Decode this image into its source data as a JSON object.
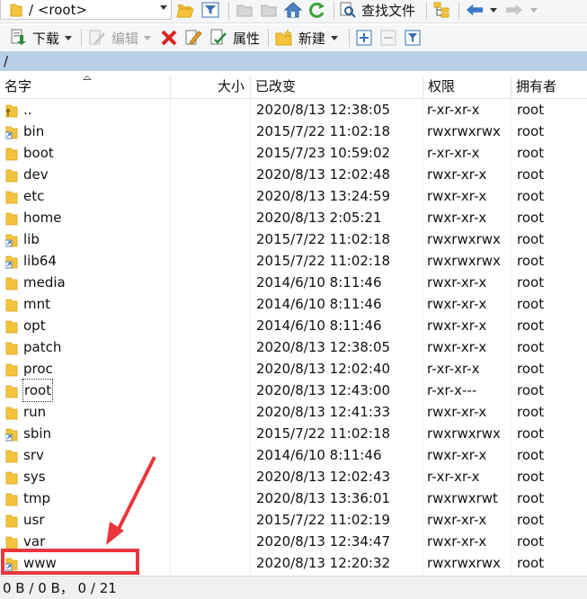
{
  "toolbar_top": {
    "path_value": "/ <root>",
    "find_label": "查找文件"
  },
  "toolbar_main": {
    "download_label": "下载",
    "edit_label": "编辑",
    "properties_label": "属性",
    "new_label": "新建"
  },
  "path_bar": {
    "path": "/"
  },
  "columns": {
    "name": "名字",
    "size": "大小",
    "modified": "已改变",
    "permissions": "权限",
    "owner": "拥有者"
  },
  "rows": [
    {
      "name": "..",
      "modified": "2020/8/13 12:38:05",
      "permissions": "r-xr-xr-x",
      "owner": "root",
      "icon": "parent-folder-icon"
    },
    {
      "name": "bin",
      "modified": "2015/7/22 11:02:18",
      "permissions": "rwxrwxrwx",
      "owner": "root",
      "icon": "folder-link-icon"
    },
    {
      "name": "boot",
      "modified": "2015/7/23 10:59:02",
      "permissions": "r-xr-xr-x",
      "owner": "root",
      "icon": "folder-icon"
    },
    {
      "name": "dev",
      "modified": "2020/8/13 12:02:48",
      "permissions": "rwxr-xr-x",
      "owner": "root",
      "icon": "folder-icon"
    },
    {
      "name": "etc",
      "modified": "2020/8/13 13:24:59",
      "permissions": "rwxr-xr-x",
      "owner": "root",
      "icon": "folder-icon"
    },
    {
      "name": "home",
      "modified": "2020/8/13 2:05:21",
      "permissions": "rwxr-xr-x",
      "owner": "root",
      "icon": "folder-icon"
    },
    {
      "name": "lib",
      "modified": "2015/7/22 11:02:18",
      "permissions": "rwxrwxrwx",
      "owner": "root",
      "icon": "folder-link-icon"
    },
    {
      "name": "lib64",
      "modified": "2015/7/22 11:02:18",
      "permissions": "rwxrwxrwx",
      "owner": "root",
      "icon": "folder-link-icon"
    },
    {
      "name": "media",
      "modified": "2014/6/10 8:11:46",
      "permissions": "rwxr-xr-x",
      "owner": "root",
      "icon": "folder-icon"
    },
    {
      "name": "mnt",
      "modified": "2014/6/10 8:11:46",
      "permissions": "rwxr-xr-x",
      "owner": "root",
      "icon": "folder-icon"
    },
    {
      "name": "opt",
      "modified": "2014/6/10 8:11:46",
      "permissions": "rwxr-xr-x",
      "owner": "root",
      "icon": "folder-icon"
    },
    {
      "name": "patch",
      "modified": "2020/8/13 12:38:05",
      "permissions": "rwxr-xr-x",
      "owner": "root",
      "icon": "folder-icon"
    },
    {
      "name": "proc",
      "modified": "2020/8/13 12:02:40",
      "permissions": "r-xr-xr-x",
      "owner": "root",
      "icon": "folder-icon"
    },
    {
      "name": "root",
      "modified": "2020/8/13 12:43:00",
      "permissions": "r-xr-x---",
      "owner": "root",
      "icon": "folder-icon",
      "focused": true
    },
    {
      "name": "run",
      "modified": "2020/8/13 12:41:33",
      "permissions": "rwxr-xr-x",
      "owner": "root",
      "icon": "folder-icon"
    },
    {
      "name": "sbin",
      "modified": "2015/7/22 11:02:18",
      "permissions": "rwxrwxrwx",
      "owner": "root",
      "icon": "folder-link-icon"
    },
    {
      "name": "srv",
      "modified": "2014/6/10 8:11:46",
      "permissions": "rwxr-xr-x",
      "owner": "root",
      "icon": "folder-icon"
    },
    {
      "name": "sys",
      "modified": "2020/8/13 12:02:43",
      "permissions": "r-xr-xr-x",
      "owner": "root",
      "icon": "folder-icon"
    },
    {
      "name": "tmp",
      "modified": "2020/8/13 13:36:01",
      "permissions": "rwxrwxrwt",
      "owner": "root",
      "icon": "folder-icon"
    },
    {
      "name": "usr",
      "modified": "2015/7/22 11:02:19",
      "permissions": "rwxr-xr-x",
      "owner": "root",
      "icon": "folder-icon"
    },
    {
      "name": "var",
      "modified": "2020/8/13 12:34:47",
      "permissions": "rwxr-xr-x",
      "owner": "root",
      "icon": "folder-icon"
    },
    {
      "name": "www",
      "modified": "2020/8/13 12:20:32",
      "permissions": "rwxrwxrwx",
      "owner": "root",
      "icon": "folder-link-icon"
    }
  ],
  "status_bar": {
    "text": "0 B / 0 B，  0 / 21"
  },
  "colors": {
    "folder": "#f5c23b",
    "path_bar": "#b8cfe6",
    "annotation": "#e8373d"
  }
}
